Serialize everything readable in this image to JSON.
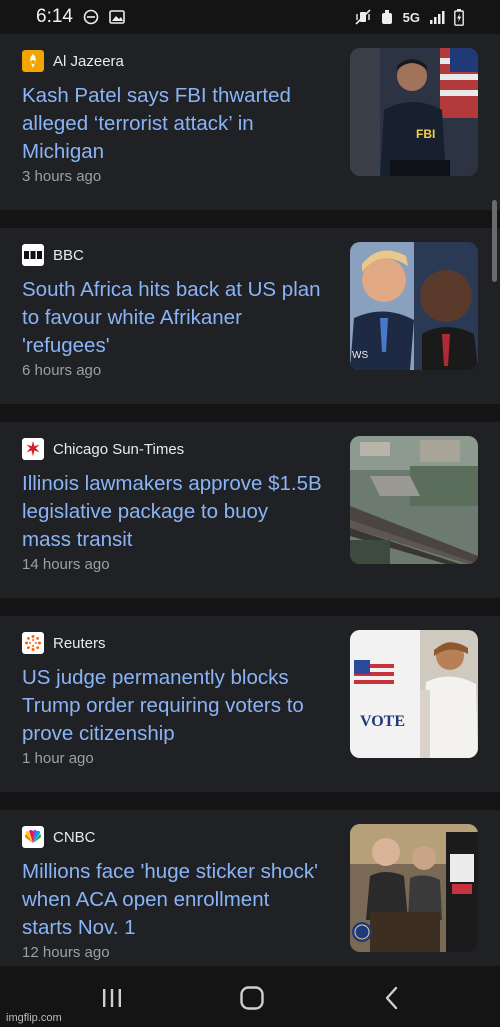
{
  "status_bar": {
    "time": "6:14",
    "network": "5G"
  },
  "articles": [
    {
      "source": "Al Jazeera",
      "headline": "Kash Patel says FBI thwarted alleged ‘terrorist attack’ in Michigan",
      "time": "3 hours ago",
      "thumb_text": "FBI"
    },
    {
      "source": "BBC",
      "headline": "South Africa hits back at US plan to favour white Afrikaner 'refugees'",
      "time": "6 hours ago",
      "thumb_text": "WS"
    },
    {
      "source": "Chicago Sun-Times",
      "headline": "Illinois lawmakers approve $1.5B legislative package to buoy mass transit",
      "time": "14 hours ago"
    },
    {
      "source": "Reuters",
      "headline": "US judge permanently blocks Trump order requiring voters to prove citizenship",
      "time": "1 hour ago",
      "thumb_text": "VOTE"
    },
    {
      "source": "CNBC",
      "headline": "Millions face 'huge sticker shock' when ACA open enrollment starts Nov. 1",
      "time": "12 hours ago"
    }
  ],
  "watermark": "imgflip.com",
  "colors": {
    "headline": "#8ab4f8",
    "background": "#1b1b1b",
    "card": "#202124"
  }
}
